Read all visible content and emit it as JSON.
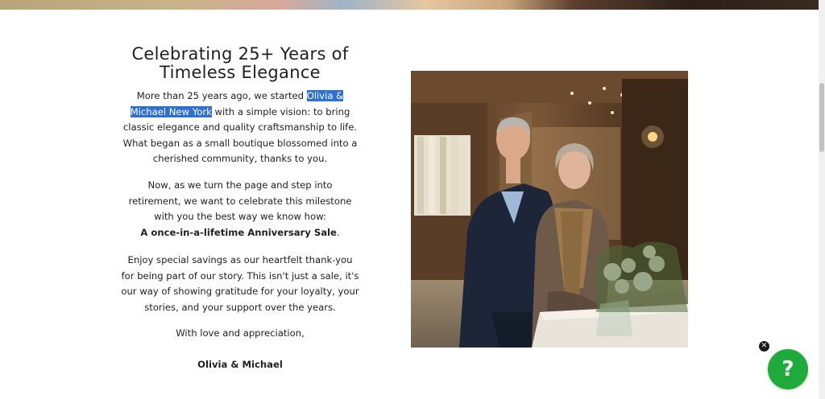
{
  "title_line1": "Celebrating 25+ Years of",
  "title_line2": "Timeless Elegance",
  "p1_before": "More than 25 years ago, we started ",
  "p1_highlight": "Olivia & Michael New York",
  "p1_after": " with a simple vision: to bring classic elegance and quality craftsmanship to life. What began as a small boutique blossomed into a cherished community, thanks to you.",
  "p2_text": "Now, as we turn the page and step into retirement, we want to celebrate this milestone with you the best way we know how:",
  "p2_bold": "A once-in-a-lifetime Anniversary Sale",
  "p2_end": ".",
  "p3_text": "Enjoy special savings as our heartfelt thank-you for being part of our story. This isn't just a sale, it's our way of showing gratitude for your loyalty, your stories, and your support over the years.",
  "closing": "With love and appreciation,",
  "signature": "Olivia & Michael",
  "help_icon_glyph": "?",
  "close_icon_glyph": "✕",
  "colors": {
    "highlight": "#2f6fd0",
    "help_button": "#1faa3c"
  },
  "icons": [
    "close-icon",
    "question-mark-icon"
  ]
}
